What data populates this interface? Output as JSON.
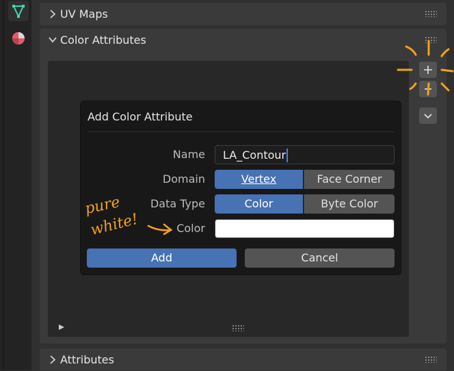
{
  "panels": {
    "uv_maps": {
      "label": "UV Maps"
    },
    "color_attributes": {
      "label": "Color Attributes"
    },
    "attributes": {
      "label": "Attributes"
    }
  },
  "icons": {
    "data_tab": "mesh-data-icon",
    "material_tab": "material-icon",
    "add": "plus-icon",
    "remove": "minus-icon",
    "menu": "chevron-down-icon",
    "expand": "triangle-right-icon"
  },
  "colors": {
    "accent": "#4772b3",
    "annotation": "#f2a21a",
    "mesh_icon": "#3ed6b0",
    "swatch": "#ffffff"
  },
  "dialog": {
    "title": "Add Color Attribute",
    "name_label": "Name",
    "name_value": "LA_Contour",
    "domain_label": "Domain",
    "domain_options": [
      "Vertex",
      "Face Corner"
    ],
    "domain_selected": "Vertex",
    "data_type_label": "Data Type",
    "data_type_options": [
      "Color",
      "Byte Color"
    ],
    "data_type_selected": "Color",
    "color_label": "Color",
    "add_label": "Add",
    "cancel_label": "Cancel"
  },
  "annotation": {
    "line1": "pure",
    "line2": "white!"
  }
}
